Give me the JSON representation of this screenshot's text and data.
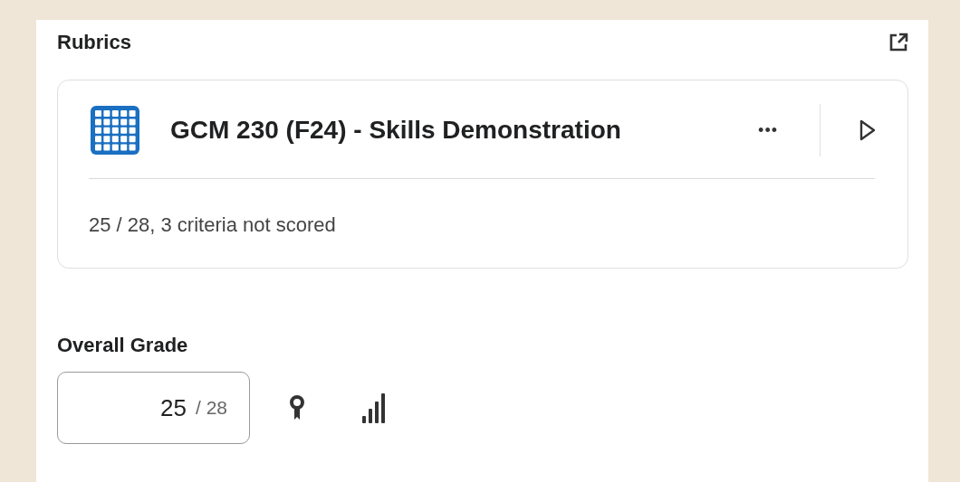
{
  "section": {
    "title": "Rubrics"
  },
  "rubric": {
    "title": "GCM 230 (F24) - Skills Demonstration",
    "more": "•••",
    "summary": "25 / 28, 3 criteria not scored"
  },
  "grade": {
    "label": "Overall Grade",
    "value": "25",
    "out_of": "/ 28"
  }
}
